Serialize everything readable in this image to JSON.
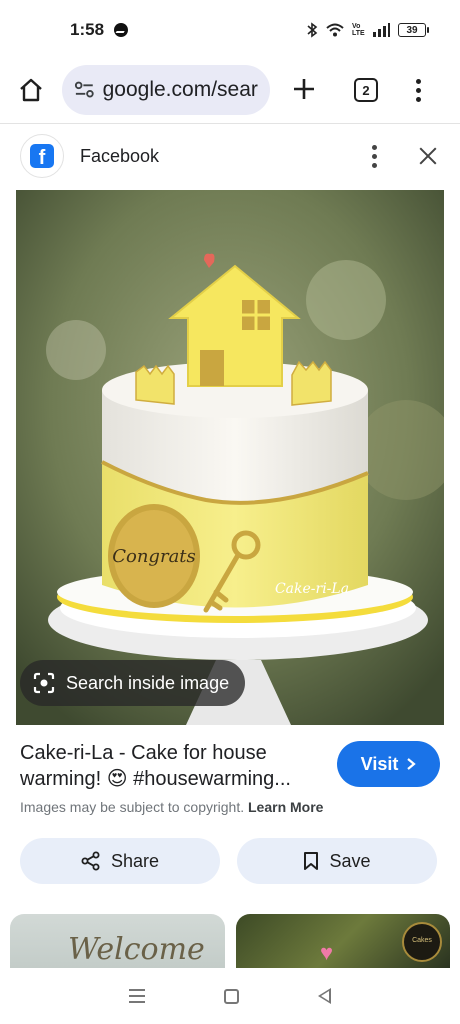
{
  "status_bar": {
    "time": "1:58",
    "network_label": "Vo LTE",
    "battery": "39",
    "icons": [
      "messenger-icon",
      "bluetooth-icon",
      "wifi-icon",
      "signal-icon",
      "battery-icon"
    ]
  },
  "browser": {
    "url": "google.com/searc",
    "tab_count": "2",
    "icons": [
      "home-icon",
      "site-settings-icon",
      "plus-icon",
      "tabs-icon",
      "more-vert-icon"
    ]
  },
  "source": {
    "name": "Facebook",
    "logo_letter": "f",
    "icons": [
      "facebook-logo-icon",
      "more-vert-icon",
      "close-icon"
    ]
  },
  "image": {
    "lens_label": "Search inside image",
    "cake_plaque_text": "Congrats",
    "cake_brand_text": "Cake-ri-La",
    "colors": {
      "cake_yellow": "#f4ea7a",
      "gold": "#c9a640",
      "frosting": "#f3f1ec"
    }
  },
  "result": {
    "title": "Cake-ri-La - Cake for house warming! 😍 #housewarming...",
    "visit_label": "Visit",
    "copyright_text": "Images may be subject to copyright.",
    "learn_more_label": "Learn More",
    "share_label": "Share",
    "save_label": "Save"
  },
  "related": {
    "item1_text": "Welcome",
    "item2_badge": "Cakes"
  },
  "nav": {
    "icons": [
      "recent-apps-icon",
      "home-nav-icon",
      "back-icon"
    ]
  },
  "colors": {
    "accent": "#1a73e8",
    "pill_background": "#e8eef9",
    "url_background": "#e9eaf6"
  }
}
